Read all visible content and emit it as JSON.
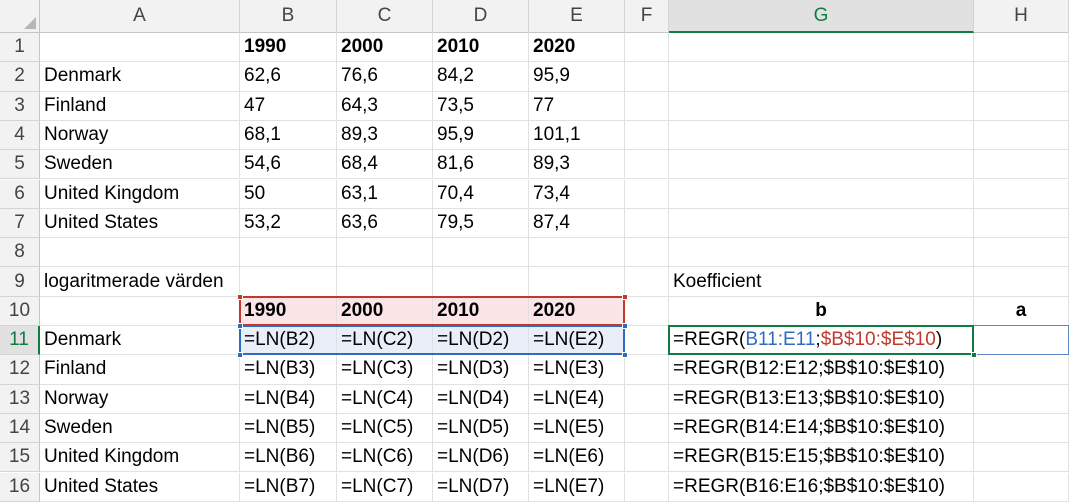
{
  "columns": [
    "A",
    "B",
    "C",
    "D",
    "E",
    "F",
    "G",
    "H"
  ],
  "rows": [
    "1",
    "2",
    "3",
    "4",
    "5",
    "6",
    "7",
    "8",
    "9",
    "10",
    "11",
    "12",
    "13",
    "14",
    "15",
    "16"
  ],
  "cells": {
    "B1": "1990",
    "C1": "2000",
    "D1": "2010",
    "E1": "2020",
    "A2": "Denmark",
    "B2": "62,6",
    "C2": "76,6",
    "D2": "84,2",
    "E2": "95,9",
    "A3": "Finland",
    "B3": "47",
    "C3": "64,3",
    "D3": "73,5",
    "E3": "77",
    "A4": "Norway",
    "B4": "68,1",
    "C4": "89,3",
    "D4": "95,9",
    "E4": "101,1",
    "A5": "Sweden",
    "B5": "54,6",
    "C5": "68,4",
    "D5": "81,6",
    "E5": "89,3",
    "A6": "United Kingdom",
    "B6": "50",
    "C6": "63,1",
    "D6": "70,4",
    "E6": "73,4",
    "A7": "United States",
    "B7": "53,2",
    "C7": "63,6",
    "D7": "79,5",
    "E7": "87,4",
    "A9": "logaritmerade värden",
    "G9": "Koefficient",
    "B10": "1990",
    "C10": "2000",
    "D10": "2010",
    "E10": "2020",
    "G10": "b",
    "H10": "a",
    "A11": "Denmark",
    "B11": "=LN(B2)",
    "C11": "=LN(C2)",
    "D11": "=LN(D2)",
    "E11": "=LN(E2)",
    "A12": "Finland",
    "B12": "=LN(B3)",
    "C12": "=LN(C3)",
    "D12": "=LN(D3)",
    "E12": "=LN(E3)",
    "G12": "=REGR(B12:E12;$B$10:$E$10)",
    "A13": "Norway",
    "B13": "=LN(B4)",
    "C13": "=LN(C4)",
    "D13": "=LN(D4)",
    "E13": "=LN(E4)",
    "G13": "=REGR(B13:E13;$B$10:$E$10)",
    "A14": "Sweden",
    "B14": "=LN(B5)",
    "C14": "=LN(C5)",
    "D14": "=LN(D5)",
    "E14": "=LN(E5)",
    "G14": "=REGR(B14:E14;$B$10:$E$10)",
    "A15": "United Kingdom",
    "B15": "=LN(B6)",
    "C15": "=LN(C6)",
    "D15": "=LN(D6)",
    "E15": "=LN(E6)",
    "G15": "=REGR(B15:E15;$B$10:$E$10)",
    "A16": "United States",
    "B16": "=LN(B7)",
    "C16": "=LN(C7)",
    "D16": "=LN(D7)",
    "E16": "=LN(E7)",
    "G16": "=REGR(B16:E16;$B$10:$E$10)"
  },
  "active_cell": {
    "ref": "G11",
    "formula_prefix": "=REGR(",
    "formula_arg1": "B11:E11",
    "formula_sep": ";",
    "formula_arg2": "$B$10:$E$10",
    "formula_suffix": ")"
  },
  "bold_cells": [
    "B1",
    "C1",
    "D1",
    "E1",
    "B10",
    "C10",
    "D10",
    "E10",
    "G10",
    "H10"
  ],
  "center_cells": [
    "G10",
    "H10"
  ],
  "colors": {
    "selection_green": "#107c41",
    "ref_blue": "#2f6bc1",
    "ref_red": "#c0392b",
    "ref_red_fill": "#fbe5e7",
    "ref_blue_fill": "#e9eef8"
  }
}
